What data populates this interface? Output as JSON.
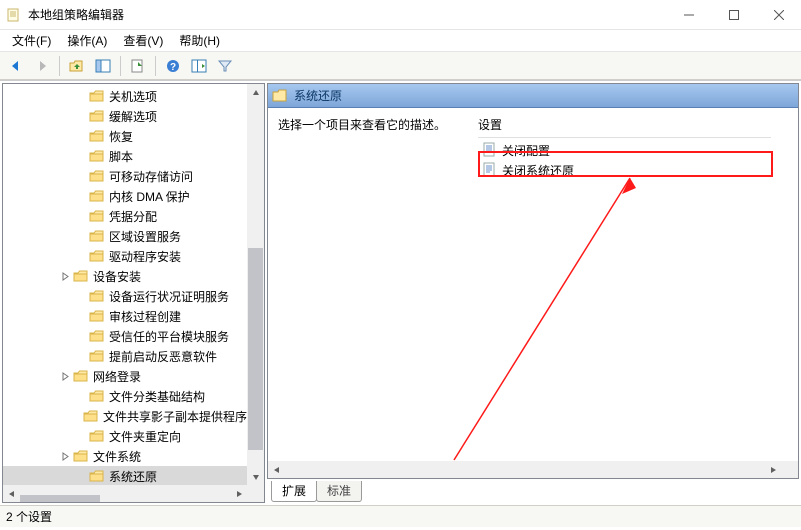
{
  "window": {
    "title": "本地组策略编辑器"
  },
  "menu": {
    "file": "文件(F)",
    "action": "操作(A)",
    "view": "查看(V)",
    "help": "帮助(H)"
  },
  "toolbar_icons": {
    "back": "back-arrow",
    "forward": "forward-arrow",
    "up": "up-folder",
    "show_hide": "show-hide-tree",
    "export": "export-list",
    "help": "help",
    "extended": "extended-view",
    "filter": "filter"
  },
  "tree": {
    "items": [
      {
        "indent": 4,
        "exp": "",
        "label": "关机选项"
      },
      {
        "indent": 4,
        "exp": "",
        "label": "缓解选项"
      },
      {
        "indent": 4,
        "exp": "",
        "label": "恢复"
      },
      {
        "indent": 4,
        "exp": "",
        "label": "脚本"
      },
      {
        "indent": 4,
        "exp": "",
        "label": "可移动存储访问"
      },
      {
        "indent": 4,
        "exp": "",
        "label": "内核 DMA 保护"
      },
      {
        "indent": 4,
        "exp": "",
        "label": "凭据分配"
      },
      {
        "indent": 4,
        "exp": "",
        "label": "区域设置服务"
      },
      {
        "indent": 4,
        "exp": "",
        "label": "驱动程序安装"
      },
      {
        "indent": 3,
        "exp": ">",
        "label": "设备安装"
      },
      {
        "indent": 4,
        "exp": "",
        "label": "设备运行状况证明服务"
      },
      {
        "indent": 4,
        "exp": "",
        "label": "审核过程创建"
      },
      {
        "indent": 4,
        "exp": "",
        "label": "受信任的平台模块服务"
      },
      {
        "indent": 4,
        "exp": "",
        "label": "提前启动反恶意软件"
      },
      {
        "indent": 3,
        "exp": ">",
        "label": "网络登录"
      },
      {
        "indent": 4,
        "exp": "",
        "label": "文件分类基础结构"
      },
      {
        "indent": 4,
        "exp": "",
        "label": "文件共享影子副本提供程序"
      },
      {
        "indent": 4,
        "exp": "",
        "label": "文件夹重定向"
      },
      {
        "indent": 3,
        "exp": ">",
        "label": "文件系统"
      },
      {
        "indent": 4,
        "exp": "",
        "label": "系统还原",
        "selected": true
      }
    ]
  },
  "right": {
    "header": "系统还原",
    "description": "选择一个项目来查看它的描述。",
    "settings_col": "设置",
    "items": [
      "关闭配置",
      "关闭系统还原"
    ]
  },
  "tabs": {
    "extended": "扩展",
    "standard": "标准"
  },
  "status": {
    "text": "2 个设置"
  }
}
